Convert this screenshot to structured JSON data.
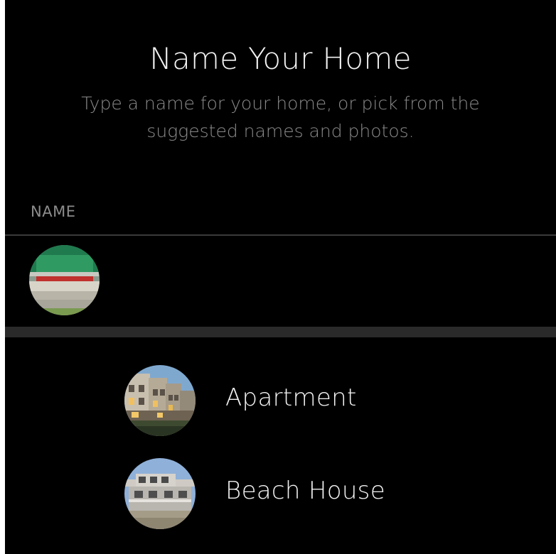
{
  "header": {
    "title": "Name Your Home",
    "subtitle": "Type a name for your home, or pick from the suggested names and photos."
  },
  "name_section": {
    "label": "NAME",
    "value": "",
    "avatar_icon": "home-photo-icon"
  },
  "suggestions": [
    {
      "label": "Apartment",
      "icon": "apartment-photo-icon"
    },
    {
      "label": "Beach House",
      "icon": "beach-house-photo-icon"
    }
  ],
  "colors": {
    "background": "#000000",
    "text_primary": "#f2f2f2",
    "text_secondary": "#8a8a8a",
    "separator": "#2a2a2a"
  }
}
